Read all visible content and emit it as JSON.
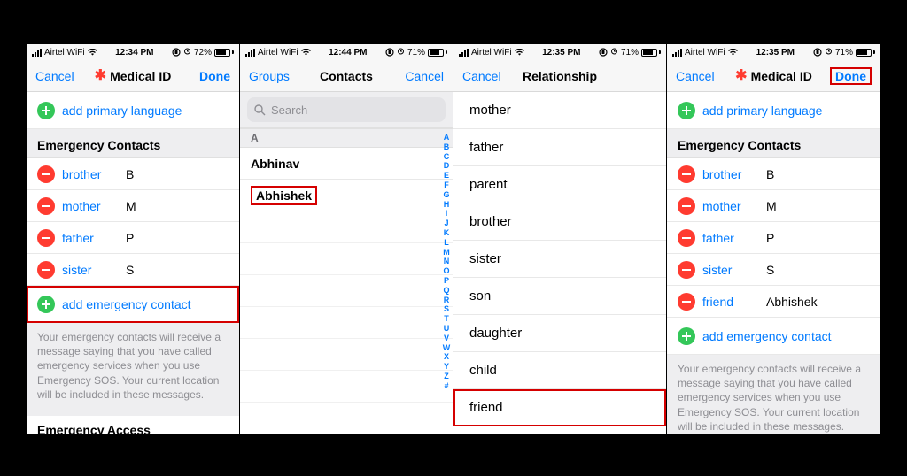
{
  "status": {
    "carrier": "Airtel WiFi",
    "battery": [
      "72%",
      "71%",
      "71%",
      "71%"
    ],
    "times": [
      "12:34 PM",
      "12:44 PM",
      "12:35 PM",
      "12:35 PM"
    ]
  },
  "screen1": {
    "nav_left": "Cancel",
    "nav_title": "Medical ID",
    "nav_right": "Done",
    "add_lang": "add primary language",
    "section": "Emergency Contacts",
    "contacts": [
      {
        "rel": "brother",
        "name": "B"
      },
      {
        "rel": "mother",
        "name": "M"
      },
      {
        "rel": "father",
        "name": "P"
      },
      {
        "rel": "sister",
        "name": "S"
      }
    ],
    "add_contact": "add emergency contact",
    "note": "Your emergency contacts will receive a message saying that you have called emergency services when you use Emergency SOS. Your current location will be included in these messages.",
    "truncated": "Emergency Access"
  },
  "screen2": {
    "nav_left": "Groups",
    "nav_title": "Contacts",
    "nav_right": "Cancel",
    "search_ph": "Search",
    "letter": "A",
    "contacts": [
      "Abhinav",
      "Abhishek"
    ],
    "index": [
      "A",
      "B",
      "C",
      "D",
      "E",
      "F",
      "G",
      "H",
      "I",
      "J",
      "K",
      "L",
      "M",
      "N",
      "O",
      "P",
      "Q",
      "R",
      "S",
      "T",
      "U",
      "V",
      "W",
      "X",
      "Y",
      "Z",
      "#"
    ]
  },
  "screen3": {
    "nav_left": "Cancel",
    "nav_title": "Relationship",
    "options": [
      "mother",
      "father",
      "parent",
      "brother",
      "sister",
      "son",
      "daughter",
      "child",
      "friend"
    ]
  },
  "screen4": {
    "nav_left": "Cancel",
    "nav_title": "Medical ID",
    "nav_right": "Done",
    "add_lang": "add primary language",
    "section": "Emergency Contacts",
    "contacts": [
      {
        "rel": "brother",
        "name": "B"
      },
      {
        "rel": "mother",
        "name": "M"
      },
      {
        "rel": "father",
        "name": "P"
      },
      {
        "rel": "sister",
        "name": "S"
      },
      {
        "rel": "friend",
        "name": "Abhishek"
      }
    ],
    "add_contact": "add emergency contact",
    "note": "Your emergency contacts will receive a message saying that you have called emergency services when you use Emergency SOS. Your current location will be included in these messages."
  }
}
